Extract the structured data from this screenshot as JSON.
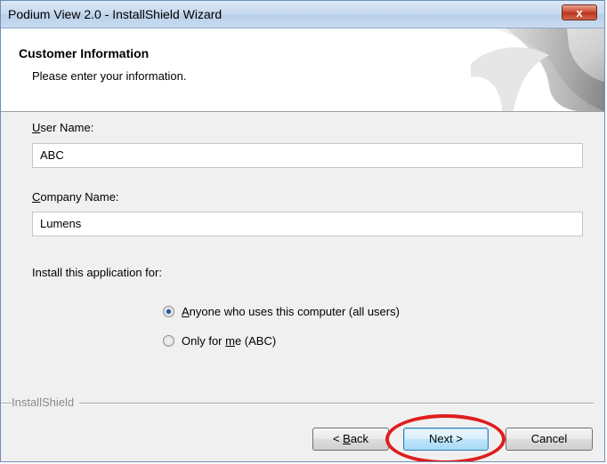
{
  "window": {
    "title": "Podium View 2.0 - InstallShield Wizard",
    "close_label": "x"
  },
  "header": {
    "title": "Customer Information",
    "subtitle": "Please enter your information."
  },
  "form": {
    "user_name_label_first": "U",
    "user_name_label_rest": "ser Name:",
    "user_name_value": "ABC",
    "company_label_first": "C",
    "company_label_rest": "ompany Name:",
    "company_value": "Lumens",
    "install_for_label": "Install this application for:",
    "options": [
      {
        "first": "A",
        "rest": "nyone who uses this computer (all users)",
        "checked": true
      },
      {
        "pre": "Only for ",
        "u": "m",
        "post": "e (ABC)",
        "checked": false
      }
    ]
  },
  "footer": {
    "brand": "InstallShield",
    "back_pre": "< ",
    "back_u": "B",
    "back_rest": "ack",
    "next_label": "Next >",
    "cancel_label": "Cancel"
  },
  "colors": {
    "highlight": "#e01d1d",
    "titlebar": "#c6d9ee"
  }
}
